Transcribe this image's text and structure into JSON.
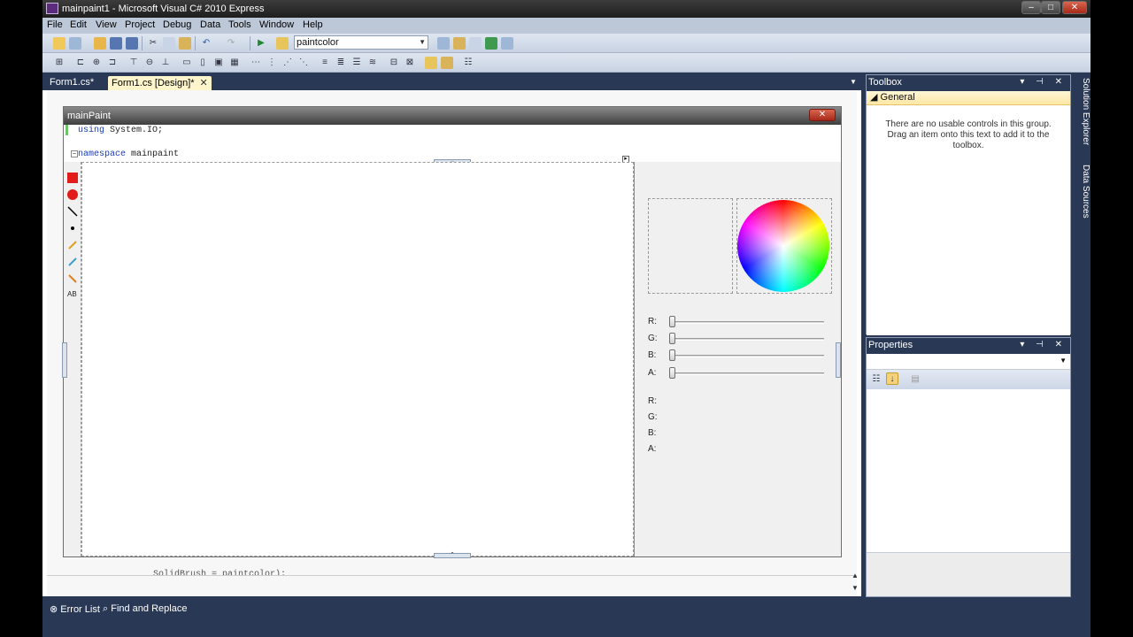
{
  "window": {
    "title": "mainpaint1 - Microsoft Visual C# 2010 Express"
  },
  "menu": [
    "File",
    "Edit",
    "View",
    "Project",
    "Debug",
    "Data",
    "Tools",
    "Window",
    "Help"
  ],
  "toolbar": {
    "config_combo_value": "paintcolor"
  },
  "doc_tabs": [
    {
      "label": "Form1.cs*"
    },
    {
      "label": "Form1.cs [Design]*"
    }
  ],
  "designer": {
    "form_title": "mainPaint",
    "code_line1_kw": "using",
    "code_line1_rest": " System.IO;",
    "code_line2_kw": "namespace",
    "code_line2_rest": " mainpaint",
    "bottom_code": "SolidBrush = paintcolor);"
  },
  "color_panel": {
    "slider_labels": [
      "R:",
      "G:",
      "B:",
      "A:"
    ],
    "value_labels": [
      "R:",
      "G:",
      "B:",
      "A:"
    ]
  },
  "toolbox": {
    "title": "Toolbox",
    "group": "General",
    "message": "There are no usable controls in this group. Drag an item onto this text to add it to the toolbox."
  },
  "properties": {
    "title": "Properties"
  },
  "side_tabs": [
    "Solution Explorer",
    "Data Sources"
  ],
  "bottom_tabs": [
    "Error List",
    "Find and Replace"
  ],
  "colors": {
    "chrome": "#293955",
    "active_tab": "#fff5cc"
  }
}
